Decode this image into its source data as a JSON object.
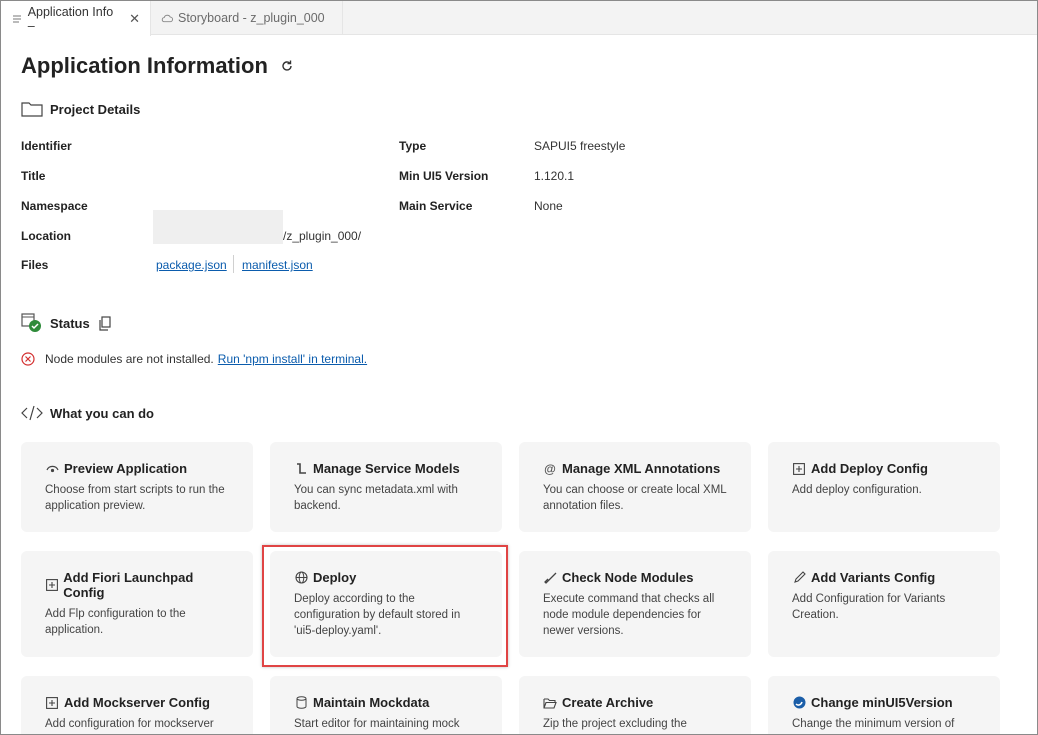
{
  "tabs": [
    {
      "label": "Application Info –",
      "close": "✕",
      "icon": "document-icon"
    },
    {
      "label": "Storyboard - z_plugin_000",
      "icon": "cloud-icon"
    }
  ],
  "page_title": "Application Information",
  "project": {
    "heading": "Project Details",
    "rows_left": [
      {
        "label": "Identifier",
        "value": ""
      },
      {
        "label": "Title",
        "value": ""
      },
      {
        "label": "Namespace",
        "value": ""
      },
      {
        "label": "Location",
        "value": "/z_plugin_000/"
      },
      {
        "label": "Files",
        "value": ""
      }
    ],
    "files": [
      "package.json",
      "manifest.json"
    ],
    "rows_right": [
      {
        "label": "Type",
        "value": "SAPUI5 freestyle"
      },
      {
        "label": "Min UI5 Version",
        "value": "1.120.1"
      },
      {
        "label": "Main Service",
        "value": "None"
      }
    ]
  },
  "status": {
    "heading": "Status",
    "message": "Node modules are not installed.",
    "action_link": "Run 'npm install' in terminal."
  },
  "actions": {
    "heading": "What you can do",
    "cards": [
      {
        "title": "Preview Application",
        "desc": "Choose from start scripts to run the application preview.",
        "icon": "eye-icon"
      },
      {
        "title": "Manage Service Models",
        "desc": "You can sync metadata.xml with backend.",
        "icon": "service-model-icon"
      },
      {
        "title": "Manage XML Annotations",
        "desc": "You can choose or create local XML annotation files.",
        "icon": "at-icon"
      },
      {
        "title": "Add Deploy Config",
        "desc": "Add deploy configuration.",
        "icon": "plus-box-icon"
      },
      {
        "title": "Add Fiori Launchpad Config",
        "desc": "Add Flp configuration to the application.",
        "icon": "plus-box-icon"
      },
      {
        "title": "Deploy",
        "desc": "Deploy according to the configuration by default stored in 'ui5-deploy.yaml'.",
        "icon": "globe-icon"
      },
      {
        "title": "Check Node Modules",
        "desc": "Execute command that checks all node module dependencies for newer versions.",
        "icon": "check-brush-icon"
      },
      {
        "title": "Add Variants Config",
        "desc": "Add Configuration for Variants Creation.",
        "icon": "pencil-icon"
      },
      {
        "title": "Add Mockserver Config",
        "desc": "Add configuration for mockserver",
        "icon": "plus-box-icon"
      },
      {
        "title": "Maintain Mockdata",
        "desc": "Start editor for maintaining mock",
        "icon": "database-icon"
      },
      {
        "title": "Create Archive",
        "desc": "Zip the project excluding the",
        "icon": "folder-open-icon"
      },
      {
        "title": "Change minUI5Version",
        "desc": "Change the minimum version of",
        "icon": "ui5-logo-icon"
      }
    ]
  },
  "colors": {
    "link": "#0b5cad",
    "card_bg": "#f5f5f5",
    "highlight": "#e04444",
    "error": "#d32f2f",
    "ok": "#2e8b3a"
  }
}
